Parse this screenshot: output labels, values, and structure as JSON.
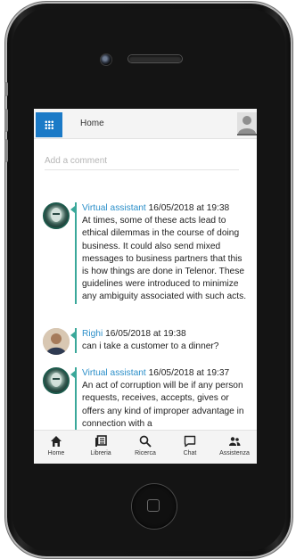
{
  "header": {
    "title": "Home"
  },
  "comment": {
    "placeholder": "Add a comment"
  },
  "messages": [
    {
      "author": "Virtual assistant",
      "timestamp": "16/05/2018 at 19:38",
      "text": "At times, some of these acts lead to ethical dilemmas in the course of doing business. It could also send mixed messages to business partners that this is how things are done in Telenor. These guidelines were introduced to minimize any ambiguity associated with such acts."
    },
    {
      "author": "Righi",
      "timestamp": "16/05/2018 at 19:38",
      "text": "can i take a customer to a dinner?"
    },
    {
      "author": "Virtual assistant",
      "timestamp": "16/05/2018 at 19:37",
      "text": "An act of corruption will be if any person requests, receives, accepts, gives or offers any kind of improper advantage in connection with a"
    }
  ],
  "tabs": [
    {
      "label": "Home",
      "icon": "home-icon"
    },
    {
      "label": "Libreria",
      "icon": "library-icon"
    },
    {
      "label": "Ricerca",
      "icon": "search-icon"
    },
    {
      "label": "Chat",
      "icon": "chat-icon"
    },
    {
      "label": "Assistenza",
      "icon": "people-icon"
    }
  ],
  "colors": {
    "accent": "#1b7ac7",
    "author": "#2b8fc9",
    "thread": "#3aa89a"
  }
}
